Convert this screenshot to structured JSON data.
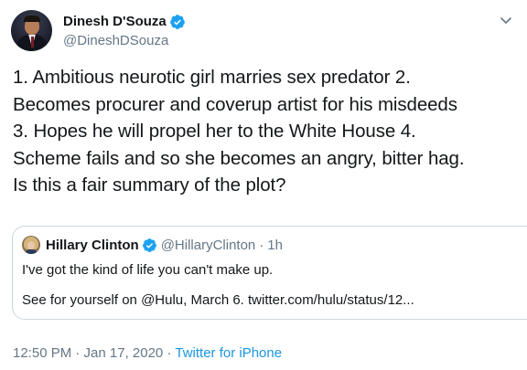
{
  "author": {
    "display_name": "Dinesh D'Souza",
    "handle": "@DineshDSouza",
    "verified": true
  },
  "tweet": {
    "lines": [
      "1. Ambitious neurotic girl marries sex predator 2.",
      "Becomes procurer and coverup artist for his misdeeds",
      "3. Hopes he will propel her to the White House 4.",
      "Scheme fails and so she becomes an angry, bitter hag.",
      "Is this a fair summary of the plot?"
    ]
  },
  "quoted_tweet": {
    "display_name": "Hillary Clinton",
    "handle": "@HillaryClinton",
    "separator": "·",
    "time": "1h",
    "verified": true,
    "line1": "I've got the kind of life you can't make up.",
    "line2": "See for yourself on @Hulu, March 6. twitter.com/hulu/status/12..."
  },
  "meta": {
    "timestamp": "12:50 PM · Jan 17, 2020",
    "separator": "·",
    "source": "Twitter for iPhone"
  },
  "icons": {
    "verified": "verified-badge-icon",
    "more": "chevron-down-icon"
  },
  "colors": {
    "text": "#14171a",
    "secondary": "#657786",
    "link": "#1b95e0",
    "verified": "#1da1f2",
    "border": "#ccd6dd"
  }
}
